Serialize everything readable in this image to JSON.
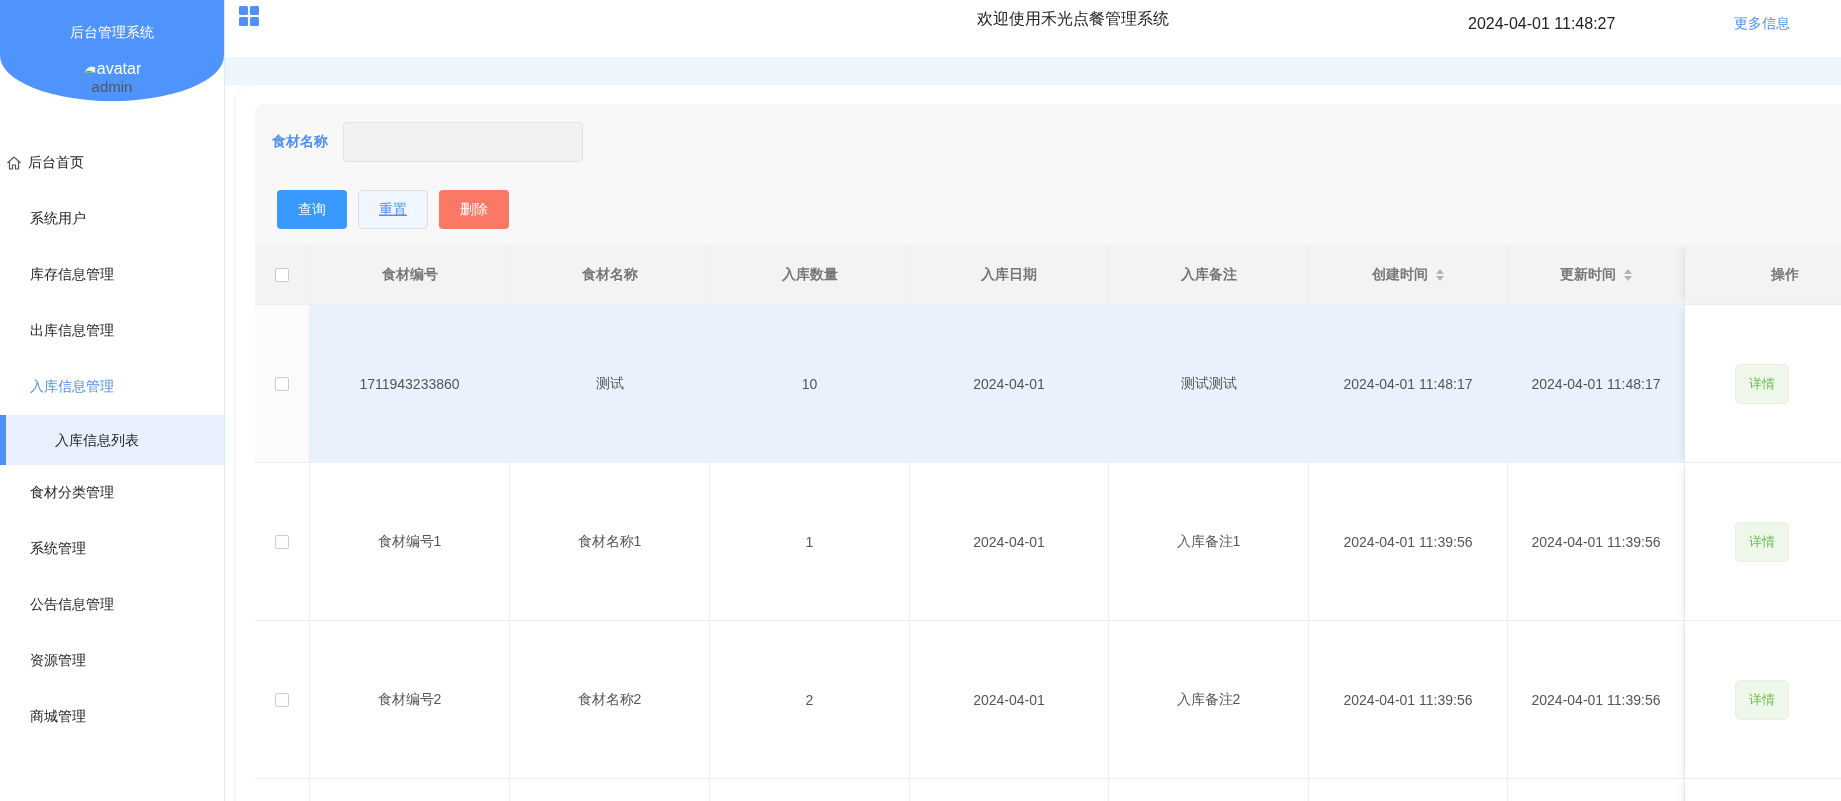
{
  "sidebar": {
    "title": "后台管理系统",
    "avatar_alt": "avatar",
    "username": "admin",
    "items": [
      {
        "label": "后台首页",
        "selected": false
      },
      {
        "label": "系统用户",
        "selected": false
      },
      {
        "label": "库存信息管理",
        "selected": false
      },
      {
        "label": "出库信息管理",
        "selected": false
      },
      {
        "label": "入库信息管理",
        "selected": true,
        "children": [
          {
            "label": "入库信息列表",
            "selected": true
          }
        ]
      },
      {
        "label": "食材分类管理",
        "selected": false
      },
      {
        "label": "系统管理",
        "selected": false
      },
      {
        "label": "公告信息管理",
        "selected": false
      },
      {
        "label": "资源管理",
        "selected": false
      },
      {
        "label": "商城管理",
        "selected": false
      }
    ]
  },
  "header": {
    "title": "欢迎使用禾光点餐管理系统",
    "datetime": "2024-04-01 11:48:27",
    "more_link": "更多信息"
  },
  "filter": {
    "label": "食材名称",
    "buttons": [
      {
        "label": "查询",
        "kind": "primary"
      },
      {
        "label": "重置",
        "kind": "plain"
      },
      {
        "label": "删除",
        "kind": "danger"
      }
    ]
  },
  "table": {
    "select_all_checked": false,
    "columns": [
      {
        "label": "食材编号",
        "sortable": false
      },
      {
        "label": "食材名称",
        "sortable": false
      },
      {
        "label": "入库数量",
        "sortable": false
      },
      {
        "label": "入库日期",
        "sortable": false
      },
      {
        "label": "入库备注",
        "sortable": false
      },
      {
        "label": "创建时间",
        "sortable": true
      },
      {
        "label": "更新时间",
        "sortable": true
      },
      {
        "label": "操作",
        "sortable": false
      }
    ],
    "rows": [
      {
        "selected": true,
        "checked": false,
        "cells": [
          "1711943233860",
          "测试",
          "10",
          "2024-04-01",
          "测试测试",
          "2024-04-01 11:48:17",
          "2024-04-01 11:48:17"
        ],
        "action": "详情"
      },
      {
        "selected": false,
        "checked": false,
        "cells": [
          "食材编号1",
          "食材名称1",
          "1",
          "2024-04-01",
          "入库备注1",
          "2024-04-01 11:39:56",
          "2024-04-01 11:39:56"
        ],
        "action": "详情"
      },
      {
        "selected": false,
        "checked": false,
        "cells": [
          "食材编号2",
          "食材名称2",
          "2",
          "2024-04-01",
          "入库备注2",
          "2024-04-01 11:39:56",
          "2024-04-01 11:39:56"
        ],
        "action": "详情"
      }
    ]
  }
}
